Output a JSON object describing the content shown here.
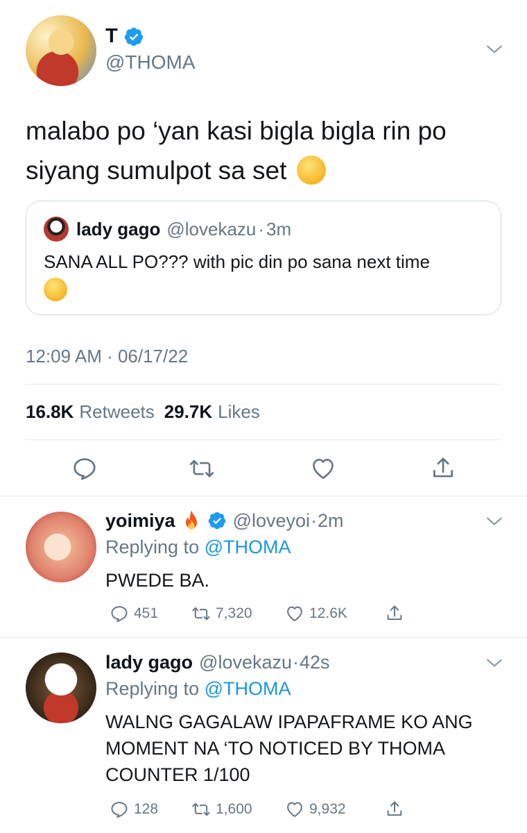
{
  "main_tweet": {
    "name": "T",
    "handle": "@THOMA",
    "text": "malabo po ‘yan kasi bigla bigla rin po siyang sumulpot sa set",
    "emoji": "rolling-on-floor-laughing-emoji",
    "quote": {
      "name": "lady gago",
      "handle": "@lovekazu",
      "separator": "·",
      "time": "3m",
      "text": "SANA ALL PO??? with pic din po sana next time",
      "emoji": "crying-face-emoji"
    },
    "timestamp": "12:09 AM · 06/17/22",
    "retweets_count": "16.8K",
    "retweets_label": "Retweets",
    "likes_count": "29.7K",
    "likes_label": "Likes"
  },
  "replies": [
    {
      "name": "yoimiya",
      "name_emoji": "fire-emoji",
      "handle": "@loveyoi",
      "separator": "·",
      "time": "2m",
      "replying_prefix": "Replying to",
      "replying_to": "@THOMA",
      "text": "PWEDE BA.",
      "reply_count": "451",
      "retweet_count": "7,320",
      "like_count": "12.6K"
    },
    {
      "name": "lady gago",
      "handle": "@lovekazu",
      "separator": "·",
      "time": "42s",
      "replying_prefix": "Replying to",
      "replying_to": "@THOMA",
      "text": "WALNG GAGALAW IPAPAFRAME KO ANG MOMENT NA ‘TO NOTICED BY THOMA COUNTER 1/100",
      "reply_count": "128",
      "retweet_count": "1,600",
      "like_count": "9,932"
    }
  ],
  "colors": {
    "text": "#0f1419",
    "secondary": "#657786",
    "link": "#1b95e0",
    "verified": "#1d9bf0",
    "divider": "#e1e8ed"
  }
}
